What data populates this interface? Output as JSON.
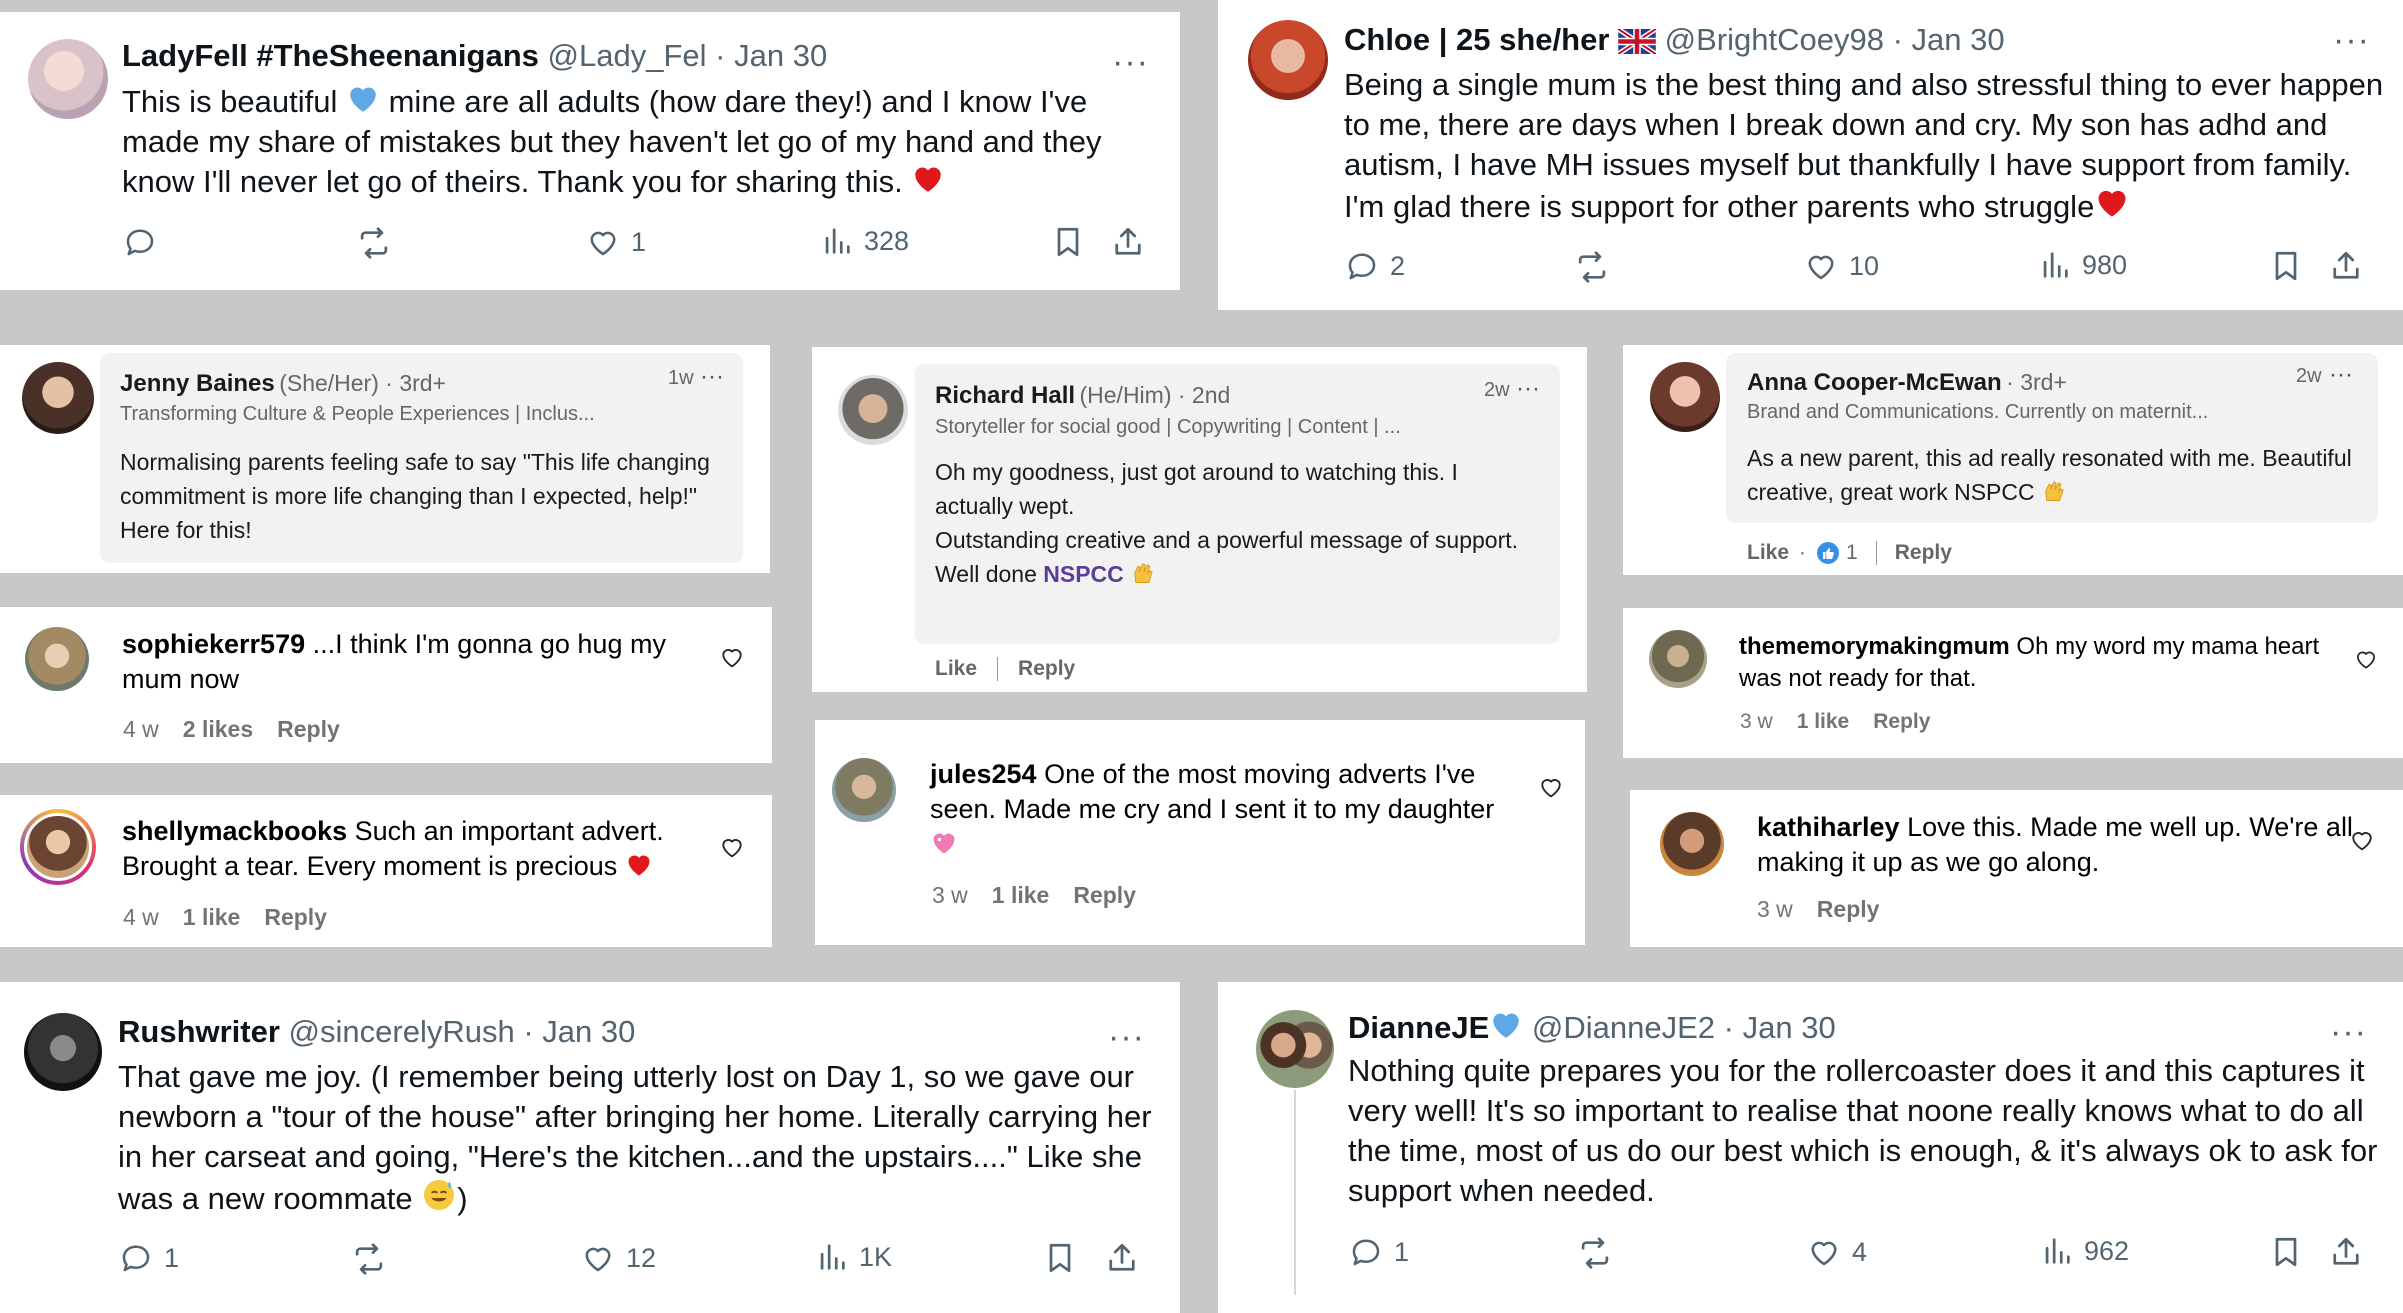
{
  "tweets": {
    "ladyfell": {
      "name": "LadyFell #TheSheenanigans",
      "handle": "@Lady_Fel",
      "date": "Jan 30",
      "text_1": "This is beautiful ",
      "text_2": " mine are all adults (how dare they!) and I know I've made my share of mistakes but they haven't let go of my hand and they know I'll never let go of theirs. Thank you for sharing this. ",
      "replies": "",
      "reposts": "",
      "likes": "1",
      "views": "328"
    },
    "chloe": {
      "name": "Chloe | 25 she/her",
      "handle": "@BrightCoey98",
      "date": "Jan 30",
      "text": "Being a single mum is the best thing and also stressful thing to ever happen to me, there are days when I break down and cry. My son has adhd and autism, I have MH issues myself but thankfully I have support from family. I'm glad there is support for other parents who struggle",
      "replies": "2",
      "reposts": "",
      "likes": "10",
      "views": "980"
    },
    "rushwriter": {
      "name": "Rushwriter",
      "handle": "@sincerelyRush",
      "date": "Jan 30",
      "text": "That gave me joy. (I remember being utterly lost on Day 1, so we gave our newborn a \"tour of the house\" after bringing her home. Literally carrying her in her carseat and going, \"Here's the kitchen...and the upstairs....\" Like she was a new roommate ",
      "text_end": ")",
      "replies": "1",
      "reposts": "",
      "likes": "12",
      "views": "1K"
    },
    "dianne": {
      "name": "DianneJE",
      "handle": "@DianneJE2",
      "date": "Jan 30",
      "text": "Nothing quite prepares you for the rollercoaster does it and this captures it very well! It's so important to realise that noone really knows what to do all the time, most of us do our best which is enough, & it's always ok to ask for support when needed.",
      "replies": "1",
      "reposts": "",
      "likes": "4",
      "views": "962"
    },
    "separator": "·",
    "more": "···"
  },
  "linkedin": {
    "jenny": {
      "name": "Jenny Baines",
      "pronouns": "(She/Her) · 3rd+",
      "headline": "Transforming Culture & People Experiences | Inclus...",
      "time": "1w",
      "text": "Normalising parents feeling safe to say \"This life changing commitment is more life changing than I expected, help!\" Here for this!"
    },
    "richard": {
      "name": "Richard Hall",
      "pronouns": "(He/Him) · 2nd",
      "headline": "Storyteller for social good | Copywriting | Content | ...",
      "time": "2w",
      "text": "Oh my goodness, just got around to watching this. I actually wept.\nOutstanding creative and a powerful message of support.\nWell done ",
      "link": "NSPCC",
      "like": "Like",
      "reply": "Reply"
    },
    "anna": {
      "name": "Anna Cooper-McEwan",
      "pronouns": "· 3rd+",
      "headline": "Brand and Communications. Currently on maternit...",
      "time": "2w",
      "text": "As a new parent, this ad really resonated with me. Beautiful creative, great work NSPCC ",
      "like": "Like",
      "reaction_count": "1",
      "reply": "Reply",
      "dot": "·"
    },
    "more": "···"
  },
  "instagram": {
    "sophie": {
      "user": "sophiekerr579",
      "text": " ...I think I'm gonna go hug my mum now",
      "time": "4 w",
      "likes": "2 likes",
      "reply": "Reply"
    },
    "shelly": {
      "user": "shellymackbooks",
      "text": " Such an important advert. Brought a tear. Every moment is precious ",
      "time": "4 w",
      "likes": "1 like",
      "reply": "Reply"
    },
    "jules": {
      "user": "jules254",
      "text": " One of the most moving adverts I've seen. Made me cry and I sent it to my daughter ",
      "time": "3 w",
      "likes": "1 like",
      "reply": "Reply"
    },
    "memory": {
      "user": "thememorymakingmum",
      "text": " Oh my word my mama heart was not ready for that.",
      "time": "3 w",
      "likes": "1 like",
      "reply": "Reply"
    },
    "kathi": {
      "user": "kathiharley",
      "text": " Love this. Made me well up. We're all making it up as we go along.",
      "time": "3 w",
      "reply": "Reply"
    }
  },
  "icons": {
    "reply": "reply-icon",
    "repost": "repost-icon",
    "like": "heart-icon",
    "views": "views-icon",
    "bookmark": "bookmark-icon",
    "share": "share-icon",
    "more": "more-icon",
    "blue_heart": "blue-heart-emoji",
    "red_heart": "red-heart-emoji",
    "pink_heart": "pink-heart-emoji",
    "clap": "raised-hands-emoji",
    "sweat": "sweat-smile-emoji",
    "flag": "uk-flag-emoji",
    "thumb": "like-reaction-icon"
  },
  "colors": {
    "background": "#c8c8c8",
    "card": "#ffffff",
    "muted": "#536471",
    "red_heart": "#e0181b",
    "blue_heart": "#5ea8e6",
    "link": "#5b3c9b"
  }
}
